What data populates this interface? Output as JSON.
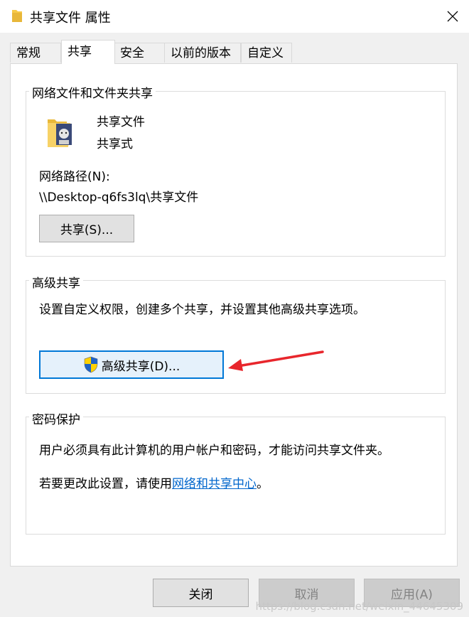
{
  "window": {
    "title": "共享文件 属性"
  },
  "tabs": [
    {
      "label": "常规"
    },
    {
      "label": "共享"
    },
    {
      "label": "安全"
    },
    {
      "label": "以前的版本"
    },
    {
      "label": "自定义"
    }
  ],
  "network_sharing": {
    "group_title": "网络文件和文件夹共享",
    "folder_name": "共享文件",
    "share_status": "共享式",
    "path_label": "网络路径(N):",
    "path_value": "\\\\Desktop-q6fs3lq\\共享文件",
    "share_button": "共享(S)..."
  },
  "advanced_sharing": {
    "group_title": "高级共享",
    "description": "设置自定义权限，创建多个共享，并设置其他高级共享选项。",
    "button": "高级共享(D)..."
  },
  "password_protection": {
    "group_title": "密码保护",
    "description": "用户必须具有此计算机的用户帐户和密码，才能访问共享文件夹。",
    "change_prefix": "若要更改此设置，请使用",
    "change_link": "网络和共享中心",
    "change_suffix": "。"
  },
  "footer": {
    "close": "关闭",
    "cancel": "取消",
    "apply": "应用(A)"
  },
  "watermark": "https://blog.csdn.net/weixin_44645309",
  "colors": {
    "accent": "#0078d7",
    "link": "#0066cc",
    "annotation_arrow": "#e8262c"
  }
}
